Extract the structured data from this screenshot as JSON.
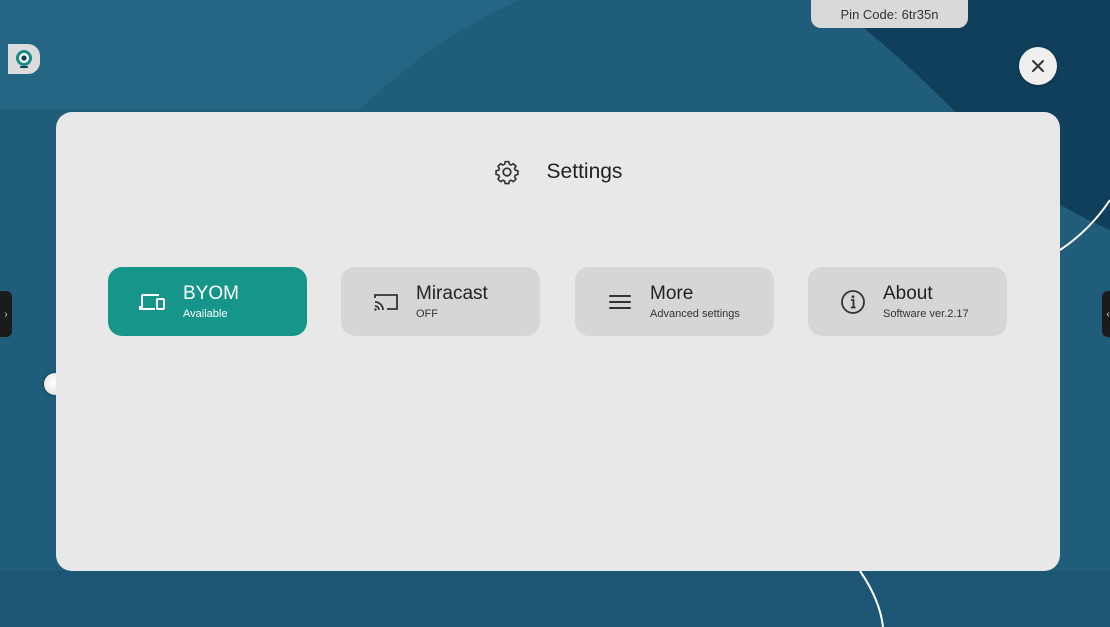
{
  "header": {
    "pin_label": "Pin Code:",
    "pin_value": "6tr35n"
  },
  "panel": {
    "title": "Settings",
    "title_icon": "gear-icon"
  },
  "cards": [
    {
      "label": "BYOM",
      "sub": "Available",
      "icon": "devices-icon",
      "active": true
    },
    {
      "label": "Miracast",
      "sub": "OFF",
      "icon": "cast-icon",
      "active": false
    },
    {
      "label": "More",
      "sub": "Advanced settings",
      "icon": "menu-icon",
      "active": false
    },
    {
      "label": "About",
      "sub": "Software ver.2.17",
      "icon": "info-icon",
      "active": false
    }
  ],
  "colors": {
    "accent": "#16968a",
    "panel": "#e8e8e8",
    "card": "#d6d6d6",
    "background": "#1f5b7a"
  }
}
